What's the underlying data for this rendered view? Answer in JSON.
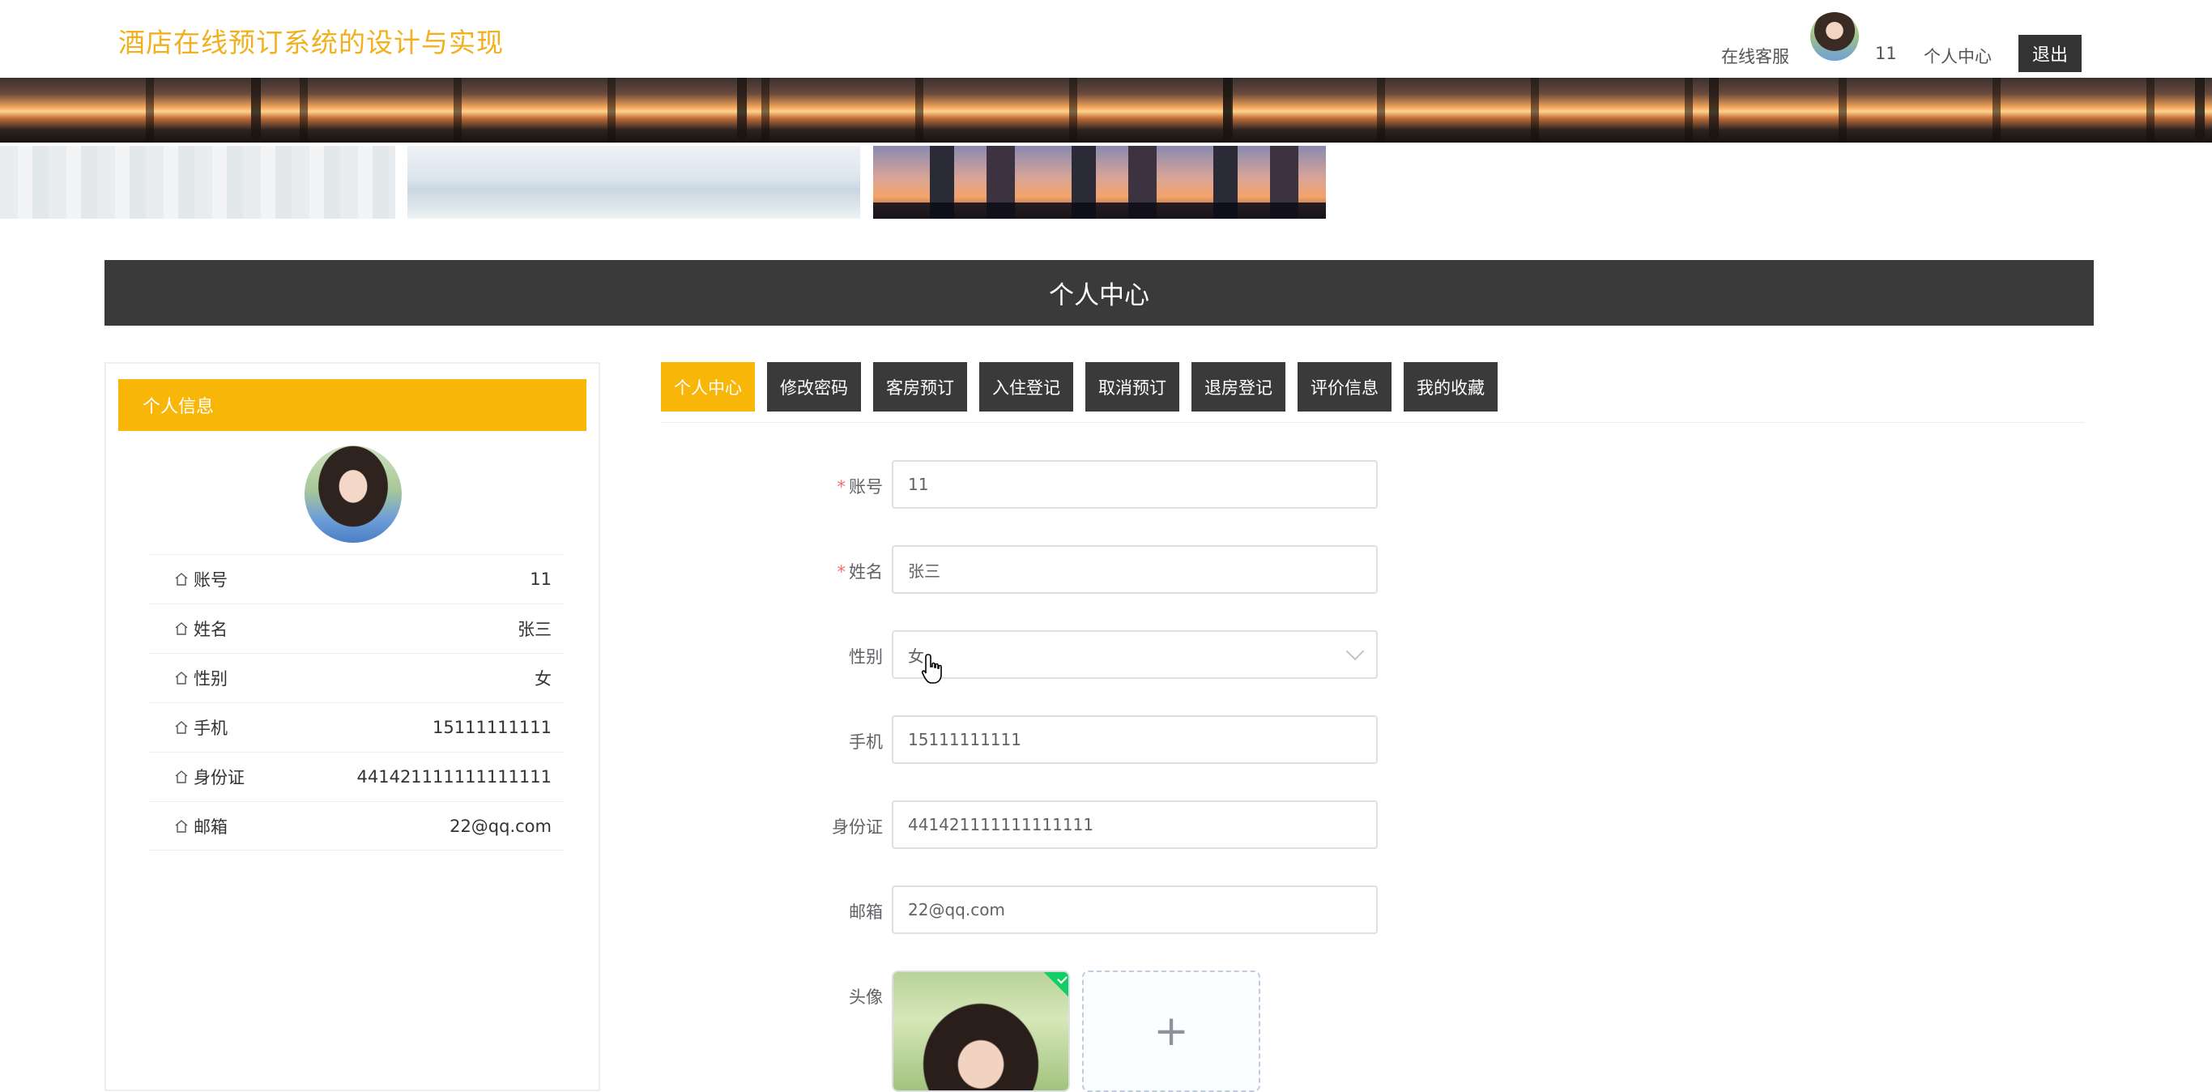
{
  "header": {
    "site_title": "酒店在线预订系统的设计与实现",
    "customer_service": "在线客服",
    "username": "11",
    "personal_center": "个人中心",
    "logout": "退出"
  },
  "section_title": "个人中心",
  "profile": {
    "heading": "个人信息",
    "rows": [
      {
        "label": "账号",
        "value": "11"
      },
      {
        "label": "姓名",
        "value": "张三"
      },
      {
        "label": "性别",
        "value": "女"
      },
      {
        "label": "手机",
        "value": "15111111111"
      },
      {
        "label": "身份证",
        "value": "441421111111111111"
      },
      {
        "label": "邮箱",
        "value": "22@qq.com"
      }
    ]
  },
  "tabs": [
    "个人中心",
    "修改密码",
    "客房预订",
    "入住登记",
    "取消预订",
    "退房登记",
    "评价信息",
    "我的收藏"
  ],
  "active_tab": "个人中心",
  "form": {
    "account": {
      "label": "账号",
      "required": true,
      "value": "11"
    },
    "name": {
      "label": "姓名",
      "required": true,
      "value": "张三"
    },
    "gender": {
      "label": "性别",
      "value": "女"
    },
    "phone": {
      "label": "手机",
      "value": "15111111111"
    },
    "id_card": {
      "label": "身份证",
      "value": "441421111111111111"
    },
    "email": {
      "label": "邮箱",
      "value": "22@qq.com"
    },
    "avatar": {
      "label": "头像",
      "add_symbol": "+"
    }
  },
  "colors": {
    "accent": "#f7b608",
    "title": "#f2b01e",
    "dark": "#3a3a3a",
    "required": "#f56c6c",
    "success": "#13ce66"
  },
  "icons": {
    "row_icon": "house-icon",
    "select_icon": "chevron-down-icon",
    "upload_icon": "plus-icon",
    "cursor": "hand-pointer-icon"
  }
}
